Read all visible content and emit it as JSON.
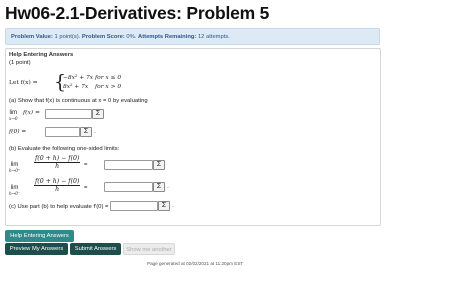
{
  "page_title": "Hw06-2.1-Derivatives: Problem 5",
  "info": {
    "value_label": "Problem Value:",
    "value": "1 point(s).",
    "score_label": "Problem Score:",
    "score": "0%.",
    "attempts_label": "Attempts Remaining:",
    "attempts": "12 attempts."
  },
  "help": {
    "title": "Help Entering Answers",
    "points": "(1 point)"
  },
  "problem": {
    "let_label": "Let f(x) =",
    "case1_expr": "−8x² + 7x",
    "case1_cond": "for x ≤ 0",
    "case2_expr": "8x² + 7x",
    "case2_cond": "for x > 0",
    "part_a": "(a)  Show that f(x) is continuous at x = 0  by evaluating",
    "lim_word": "lim",
    "lim_sub_a": "x→0",
    "lim_fx": "f(x) =",
    "f0": "f(0) =",
    "part_b": "(b) Evaluate the following one-sided limits:",
    "lim_sub_plus": "h→0⁺",
    "lim_sub_minus": "h→0⁻",
    "frac_num": "f(0 + h) − f(0)",
    "frac_den": "h",
    "equals": "=",
    "part_c": "(c) Use part (b) to help evaluate  f′(0) =",
    "sigma": "Σ",
    "dot": "."
  },
  "buttons": {
    "help_entering": "Help Entering Answers",
    "preview": "Preview My Answers",
    "submit": "Submit Answers",
    "show_other": "Show me another"
  },
  "footer": "Page generated at 02/02/2021 at 11:20pm EST",
  "colors": {
    "info_bg": "#dde9f4",
    "help_btn": "#2f8b8b",
    "dark_btn": "#1e4e4c",
    "disabled_btn": "#e8e8e8"
  }
}
